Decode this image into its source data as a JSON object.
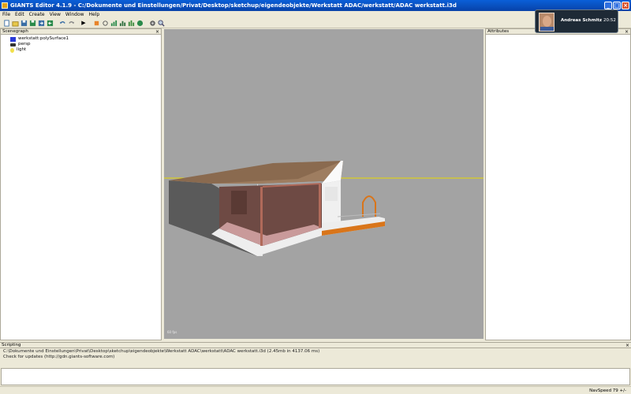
{
  "window": {
    "title": "GIANTS Editor 4.1.9 - C:/Dokumente und Einstellungen/Privat/Desktop/sketchup/eigendeobjekte/Werkstatt ADAC/werkstatt/ADAC werkstatt.i3d",
    "controls": [
      "_",
      "□",
      "×"
    ]
  },
  "menu": [
    "File",
    "Edit",
    "Create",
    "View",
    "Window",
    "Help"
  ],
  "toolbar": {
    "icons": [
      "new-icon",
      "open-icon",
      "save-icon",
      "save-as-icon",
      "export-icon",
      "import-icon",
      "undo-icon",
      "redo-icon",
      "play-icon",
      "move-icon",
      "rotate-icon",
      "scale-icon",
      "terrain-icon",
      "paint-icon",
      "foliage-icon",
      "settings-icon",
      "zoom-icon"
    ],
    "play_glyph": "▶"
  },
  "scenegraph": {
    "title": "Scenegraph",
    "close": "×",
    "items": [
      {
        "label": "werkstatt:polySurface1",
        "icon": "cube-icon"
      },
      {
        "label": "persp",
        "icon": "camera-icon"
      },
      {
        "label": "light",
        "icon": "light-icon"
      }
    ]
  },
  "viewport": {
    "overlay_text": "60 fps"
  },
  "attributes": {
    "title": "Attributes",
    "close": "×"
  },
  "scripting": {
    "title": "Scripting",
    "close": "×",
    "log": [
      "C:\\Dokumente und Einstellungen\\Privat\\Desktop\\sketchup\\eigendeobjekte\\Werkstatt ADAC\\werkstatt\\ADAC werkstatt.i3d (2.45mb in 4137.06 ms)",
      "Check for updates (http://gdn.giants-software.com)"
    ]
  },
  "status": {
    "nav_speed": "NavSpeed 79 +/-"
  },
  "user_popup": {
    "name": "Andreas Schmitz",
    "time": "20:52"
  },
  "colors": {
    "title_bar": "#0842a8",
    "viewport_bg": "#a3a3a3",
    "horizon": "#e8d800",
    "roof": "#8a6a4f"
  }
}
